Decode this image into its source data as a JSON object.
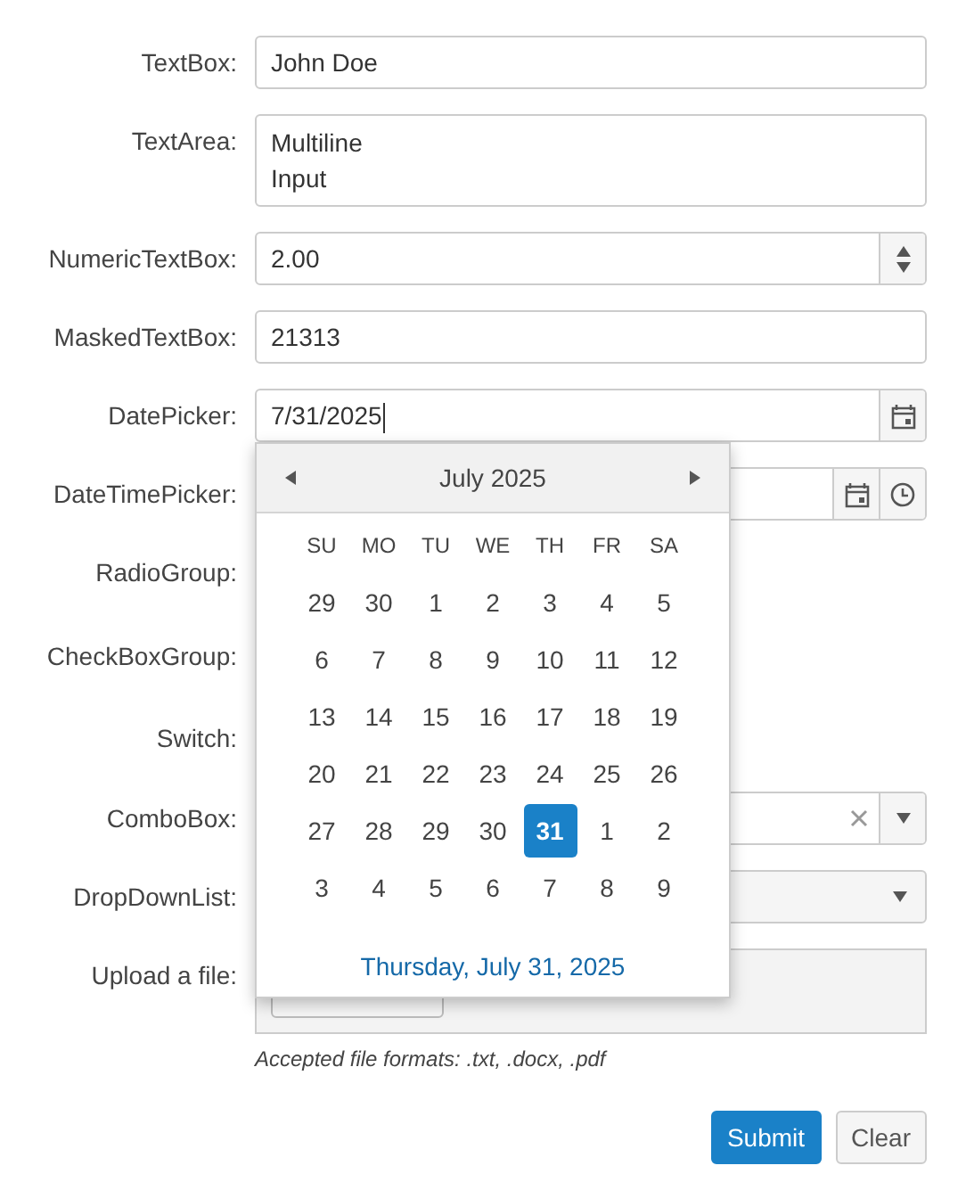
{
  "fields": [
    {
      "label": "TextBox:",
      "kind": "text",
      "value": "John Doe"
    },
    {
      "label": "TextArea:",
      "kind": "textarea",
      "lines": [
        "Multiline",
        "Input"
      ]
    },
    {
      "label": "NumericTextBox:",
      "kind": "numeric",
      "value": "2.00"
    },
    {
      "label": "MaskedTextBox:",
      "kind": "text",
      "value": "21313"
    },
    {
      "label": "DatePicker:",
      "kind": "date",
      "value": "7/31/2025"
    },
    {
      "label": "DateTimePicker:",
      "kind": "datetime"
    },
    {
      "label": "RadioGroup:",
      "kind": "radio"
    },
    {
      "label": "CheckBoxGroup:",
      "kind": "checkbox"
    },
    {
      "label": "Switch:",
      "kind": "switch"
    },
    {
      "label": "ComboBox:",
      "kind": "combobox"
    },
    {
      "label": "DropDownList:",
      "kind": "dropdown"
    },
    {
      "label": "Upload a file:",
      "kind": "upload",
      "hint": "Accepted file formats: .txt, .docx, .pdf"
    }
  ],
  "calendar": {
    "open": true,
    "title": "July 2025",
    "day_names": [
      "SU",
      "MO",
      "TU",
      "WE",
      "TH",
      "FR",
      "SA"
    ],
    "weeks": [
      [
        {
          "day": "29",
          "selected": false
        },
        {
          "day": "30",
          "selected": false
        },
        {
          "day": "1",
          "selected": false
        },
        {
          "day": "2",
          "selected": false
        },
        {
          "day": "3",
          "selected": false
        },
        {
          "day": "4",
          "selected": false
        },
        {
          "day": "5",
          "selected": false
        }
      ],
      [
        {
          "day": "6",
          "selected": false
        },
        {
          "day": "7",
          "selected": false
        },
        {
          "day": "8",
          "selected": false
        },
        {
          "day": "9",
          "selected": false
        },
        {
          "day": "10",
          "selected": false
        },
        {
          "day": "11",
          "selected": false
        },
        {
          "day": "12",
          "selected": false
        }
      ],
      [
        {
          "day": "13",
          "selected": false
        },
        {
          "day": "14",
          "selected": false
        },
        {
          "day": "15",
          "selected": false
        },
        {
          "day": "16",
          "selected": false
        },
        {
          "day": "17",
          "selected": false
        },
        {
          "day": "18",
          "selected": false
        },
        {
          "day": "19",
          "selected": false
        }
      ],
      [
        {
          "day": "20",
          "selected": false
        },
        {
          "day": "21",
          "selected": false
        },
        {
          "day": "22",
          "selected": false
        },
        {
          "day": "23",
          "selected": false
        },
        {
          "day": "24",
          "selected": false
        },
        {
          "day": "25",
          "selected": false
        },
        {
          "day": "26",
          "selected": false
        }
      ],
      [
        {
          "day": "27",
          "selected": false
        },
        {
          "day": "28",
          "selected": false
        },
        {
          "day": "29",
          "selected": false
        },
        {
          "day": "30",
          "selected": false
        },
        {
          "day": "31",
          "selected": true
        },
        {
          "day": "1",
          "selected": false
        },
        {
          "day": "2",
          "selected": false
        }
      ],
      [
        {
          "day": "3",
          "selected": false
        },
        {
          "day": "4",
          "selected": false
        },
        {
          "day": "5",
          "selected": false
        },
        {
          "day": "6",
          "selected": false
        },
        {
          "day": "7",
          "selected": false
        },
        {
          "day": "8",
          "selected": false
        },
        {
          "day": "9",
          "selected": false
        }
      ]
    ],
    "footer": "Thursday, July 31, 2025"
  },
  "buttons": [
    {
      "label": "Submit",
      "kind": "primary"
    },
    {
      "label": "Clear",
      "kind": "default"
    }
  ]
}
